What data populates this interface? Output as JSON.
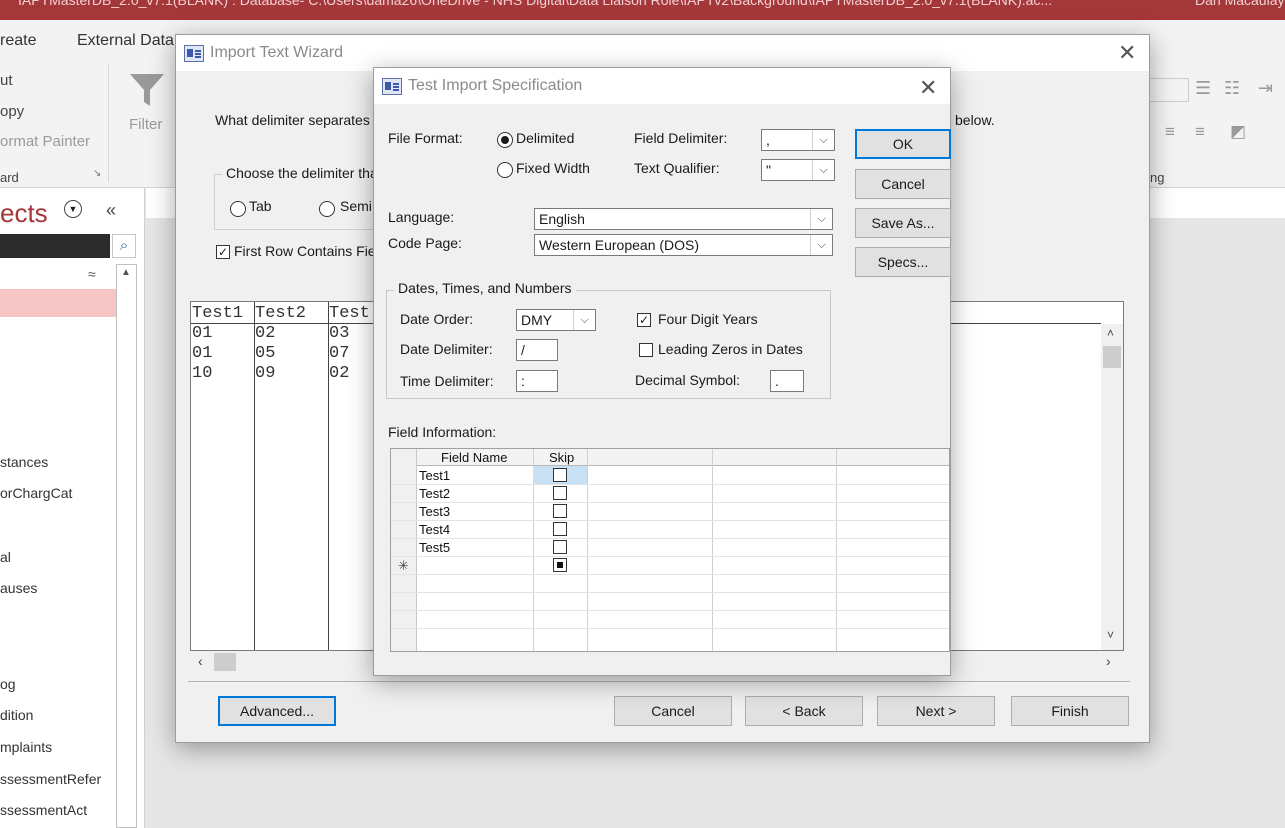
{
  "app": {
    "title_bar": "IAPTMasterDB_2.0_v7.1(BLANK) : Database- C:\\Users\\dama26\\OneDrive - NHS Digital\\Data Liaison Role\\IAPTv2\\Background\\IAPTMasterDB_2.0_v7.1(BLANK).ac...",
    "user": "Dan Macaulay",
    "accent_color": "#a4373a"
  },
  "ribbon": {
    "tab_create": "reate",
    "tab_external": "External Data",
    "cut": "ut",
    "copy": "opy",
    "format_painter": "ormat Painter",
    "clipboard_group": "ard",
    "filter": "Filter",
    "formatting_group": "ng"
  },
  "nav_pane": {
    "header": "ects",
    "items": [
      "stances",
      "orChargCat",
      "al",
      "auses",
      "og",
      "dition",
      "mplaints",
      "ssessmentRefer",
      "ssessmentAct"
    ]
  },
  "wizard": {
    "title": "Import Text Wizard",
    "question": "What delimiter separates",
    "question_tail": "below.",
    "delimiter_group_label": "Choose the delimiter tha",
    "tab_option": "Tab",
    "semicolon_option": "Semi",
    "first_row_label": "First Row Contains Fiel",
    "first_row_checked": true,
    "preview_headers": [
      "Test1",
      "Test2",
      "Test"
    ],
    "preview_rows": [
      [
        "01",
        "02",
        "03"
      ],
      [
        "01",
        "05",
        "07"
      ],
      [
        "10",
        "09",
        "02"
      ]
    ],
    "buttons": {
      "advanced": "Advanced...",
      "cancel": "Cancel",
      "back": "< Back",
      "next": "Next >",
      "finish": "Finish"
    }
  },
  "spec": {
    "title": "Test Import Specification",
    "file_format_label": "File Format:",
    "delimited": "Delimited",
    "fixed_width": "Fixed Width",
    "field_delimiter_label": "Field Delimiter:",
    "field_delimiter_value": ",",
    "text_qualifier_label": "Text Qualifier:",
    "text_qualifier_value": "\"",
    "language_label": "Language:",
    "language_value": "English",
    "code_page_label": "Code Page:",
    "code_page_value": "Western European (DOS)",
    "dtn_group": "Dates, Times, and Numbers",
    "date_order_label": "Date Order:",
    "date_order_value": "DMY",
    "date_delim_label": "Date Delimiter:",
    "date_delim_value": "/",
    "time_delim_label": "Time Delimiter:",
    "time_delim_value": ":",
    "four_digit_years": "Four Digit Years",
    "four_digit_years_checked": true,
    "leading_zeros": "Leading Zeros in Dates",
    "leading_zeros_checked": false,
    "decimal_symbol_label": "Decimal Symbol:",
    "decimal_symbol_value": ".",
    "field_info_label": "Field Information:",
    "grid_headers": [
      "Field Name",
      "Skip"
    ],
    "fields": [
      "Test1",
      "Test2",
      "Test3",
      "Test4",
      "Test5"
    ],
    "new_row_marker": "✳",
    "buttons": {
      "ok": "OK",
      "cancel": "Cancel",
      "save_as": "Save As...",
      "specs": "Specs..."
    }
  }
}
